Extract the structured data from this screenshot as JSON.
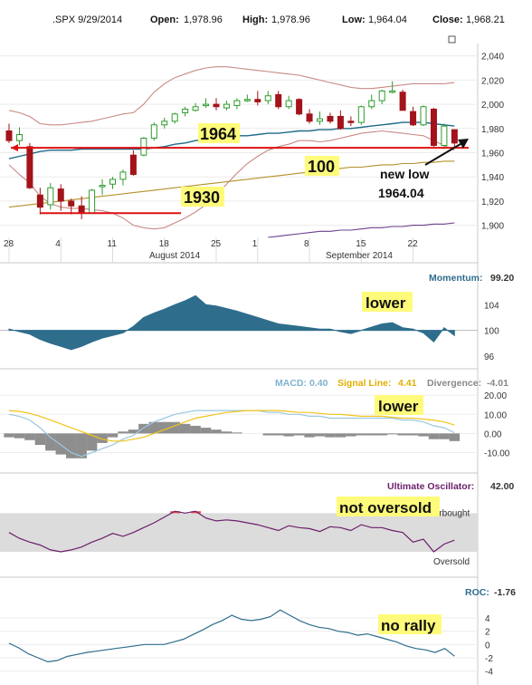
{
  "header": {
    "symbol_date": ".SPX 9/29/2014",
    "open_label": "Open:",
    "open": "1,978.96",
    "high_label": "High:",
    "high": "1,978.96",
    "low_label": "Low:",
    "low": "1,964.04",
    "close_label": "Close:",
    "close": "1,968.21"
  },
  "colors": {
    "up": "#2e9b2e",
    "down": "#a3131a",
    "bollinger": "#c98a84",
    "ma_blue": "#1f6a8a",
    "ma_olive": "#b3912a",
    "ma_purple": "#6b3f8f",
    "annotation_line": "#d11",
    "momentum": "#2f6d8c",
    "macd": "#9cc7e0",
    "signal": "#f0c419",
    "divergence": "#7a7a7a",
    "uo": "#6b1f6b",
    "uo_band": "#dcdcdc",
    "overbought_text": "#d35",
    "oversold_text": "#2aa04a",
    "roc": "#2f6d8c"
  },
  "chart_data": [
    {
      "type": "candlestick",
      "title": ".SPX 9/29/2014",
      "y_ticks": [
        "2,040",
        "2,020",
        "2,000",
        "1,980",
        "1,960",
        "1,940",
        "1,920",
        "1,900"
      ],
      "ylim": [
        1890,
        2045
      ],
      "x_tick_labels": [
        "28",
        "4",
        "11",
        "18",
        "25",
        "1",
        "8",
        "15",
        "22"
      ],
      "month_labels": [
        "August 2014",
        "September 2014"
      ],
      "candles": [
        {
          "o": 1978,
          "h": 1984,
          "l": 1968,
          "c": 1970
        },
        {
          "o": 1970,
          "h": 1981,
          "l": 1966,
          "c": 1975
        },
        {
          "o": 1965,
          "h": 1968,
          "l": 1930,
          "c": 1931
        },
        {
          "o": 1925,
          "h": 1931,
          "l": 1909,
          "c": 1915
        },
        {
          "o": 1917,
          "h": 1935,
          "l": 1913,
          "c": 1931
        },
        {
          "o": 1930,
          "h": 1934,
          "l": 1912,
          "c": 1920
        },
        {
          "o": 1920,
          "h": 1922,
          "l": 1909,
          "c": 1916
        },
        {
          "o": 1916,
          "h": 1924,
          "l": 1905,
          "c": 1910
        },
        {
          "o": 1910,
          "h": 1930,
          "l": 1910,
          "c": 1929
        },
        {
          "o": 1933,
          "h": 1938,
          "l": 1925,
          "c": 1933
        },
        {
          "o": 1934,
          "h": 1940,
          "l": 1930,
          "c": 1938
        },
        {
          "o": 1938,
          "h": 1946,
          "l": 1933,
          "c": 1944
        },
        {
          "o": 1958,
          "h": 1962,
          "l": 1941,
          "c": 1942
        },
        {
          "o": 1958,
          "h": 1973,
          "l": 1957,
          "c": 1972
        },
        {
          "o": 1972,
          "h": 1985,
          "l": 1970,
          "c": 1983
        },
        {
          "o": 1983,
          "h": 1989,
          "l": 1980,
          "c": 1986
        },
        {
          "o": 1986,
          "h": 1993,
          "l": 1984,
          "c": 1992
        },
        {
          "o": 1993,
          "h": 1998,
          "l": 1990,
          "c": 1996
        },
        {
          "o": 1995,
          "h": 2001,
          "l": 1994,
          "c": 1998
        },
        {
          "o": 1999,
          "h": 2005,
          "l": 1997,
          "c": 2000
        },
        {
          "o": 2000,
          "h": 2005,
          "l": 1995,
          "c": 1998
        },
        {
          "o": 1997,
          "h": 2003,
          "l": 1995,
          "c": 2000
        },
        {
          "o": 1999,
          "h": 2005,
          "l": 1996,
          "c": 2003
        },
        {
          "o": 2003,
          "h": 2008,
          "l": 2002,
          "c": 2004
        },
        {
          "o": 2004,
          "h": 2011,
          "l": 1999,
          "c": 2002
        },
        {
          "o": 2003,
          "h": 2011,
          "l": 2000,
          "c": 2007
        },
        {
          "o": 2008,
          "h": 2011,
          "l": 1996,
          "c": 1998
        },
        {
          "o": 1998,
          "h": 2007,
          "l": 1996,
          "c": 2003
        },
        {
          "o": 2004,
          "h": 2005,
          "l": 1991,
          "c": 1992
        },
        {
          "o": 1992,
          "h": 1996,
          "l": 1984,
          "c": 1986
        },
        {
          "o": 1986,
          "h": 1994,
          "l": 1983,
          "c": 1988
        },
        {
          "o": 1990,
          "h": 1993,
          "l": 1984,
          "c": 1986
        },
        {
          "o": 1990,
          "h": 1995,
          "l": 1979,
          "c": 1980
        },
        {
          "o": 1986,
          "h": 1990,
          "l": 1982,
          "c": 1985
        },
        {
          "o": 1985,
          "h": 1999,
          "l": 1983,
          "c": 1998
        },
        {
          "o": 1998,
          "h": 2008,
          "l": 1996,
          "c": 2003
        },
        {
          "o": 2003,
          "h": 2012,
          "l": 2000,
          "c": 2011
        },
        {
          "o": 2011,
          "h": 2019,
          "l": 2009,
          "c": 2011
        },
        {
          "o": 2010,
          "h": 2012,
          "l": 1995,
          "c": 1995
        },
        {
          "o": 1994,
          "h": 1998,
          "l": 1982,
          "c": 1983
        },
        {
          "o": 1983,
          "h": 1999,
          "l": 1982,
          "c": 1998
        },
        {
          "o": 1996,
          "h": 1997,
          "l": 1965,
          "c": 1966
        },
        {
          "o": 1966,
          "h": 1984,
          "l": 1963,
          "c": 1982
        },
        {
          "o": 1979,
          "h": 1979,
          "l": 1964,
          "c": 1968
        }
      ],
      "lines": [
        {
          "name": "bb_upper",
          "values": [
            1995,
            1993,
            1990,
            1984,
            1983,
            1983,
            1984,
            1985,
            1986,
            1988,
            1990,
            1992,
            1993,
            2000,
            2010,
            2017,
            2022,
            2025,
            2028,
            2030,
            2031,
            2031,
            2030,
            2029,
            2028,
            2027,
            2026,
            2025,
            2024,
            2022,
            2020,
            2018,
            2016,
            2014,
            2013,
            2013,
            2014,
            2015,
            2016,
            2017,
            2017,
            2017,
            2017,
            2018
          ]
        },
        {
          "name": "bb_lower",
          "values": [
            1950,
            1942,
            1935,
            1924,
            1918,
            1915,
            1914,
            1914,
            1913,
            1912,
            1910,
            1906,
            1900,
            1898,
            1897,
            1898,
            1902,
            1906,
            1911,
            1917,
            1925,
            1934,
            1943,
            1951,
            1957,
            1962,
            1965,
            1967,
            1970,
            1970,
            1969,
            1970,
            1972,
            1974,
            1976,
            1977,
            1978,
            1977,
            1976,
            1975,
            1974,
            1970,
            1966,
            1962
          ]
        },
        {
          "name": "ma_blue",
          "values": [
            1955,
            1957,
            1959,
            1961,
            1962,
            1962,
            1962,
            1963,
            1963,
            1963,
            1963,
            1963,
            1963,
            1963,
            1964,
            1965,
            1967,
            1968,
            1970,
            1971,
            1972,
            1973,
            1974,
            1974,
            1975,
            1976,
            1976,
            1977,
            1978,
            1978,
            1979,
            1979,
            1980,
            1980,
            1981,
            1982,
            1983,
            1984,
            1985,
            1985,
            1985,
            1984,
            1983,
            1982
          ]
        },
        {
          "name": "ma_olive",
          "values": [
            1915,
            1916,
            1917,
            1918,
            1919,
            1920,
            1921,
            1922,
            1923,
            1924,
            1925,
            1926,
            1927,
            1928,
            1929,
            1930,
            1931,
            1932,
            1933,
            1934,
            1935,
            1936,
            1937,
            1938,
            1939,
            1940,
            1941,
            1942,
            1943,
            1944,
            1945,
            1946,
            1947,
            1948,
            1948,
            1949,
            1950,
            1950,
            1951,
            1951,
            1952,
            1952,
            1953,
            1953
          ]
        },
        {
          "name": "ma_purple",
          "values": [
            null,
            null,
            null,
            null,
            null,
            null,
            null,
            null,
            null,
            null,
            null,
            null,
            null,
            null,
            null,
            null,
            null,
            null,
            null,
            null,
            null,
            null,
            null,
            null,
            null,
            1890,
            1891,
            1892,
            1893,
            1894,
            1895,
            1895,
            1896,
            1896,
            1897,
            1898,
            1898,
            1899,
            1899,
            1900,
            1900,
            1901,
            1901,
            1902
          ]
        }
      ],
      "annotations": {
        "level_1964": "1964",
        "level_100": "100",
        "level_1930": "1930",
        "new_low_line1": "new low",
        "new_low_line2": "1964.04"
      }
    },
    {
      "type": "area",
      "title": "Momentum:",
      "value_text": "99.20",
      "y_ticks": [
        "104",
        "100",
        "96"
      ],
      "ylim": [
        95,
        107
      ],
      "baseline": 100,
      "values": [
        100.2,
        99.8,
        99.4,
        98.6,
        98.0,
        97.5,
        97.0,
        97.5,
        98.2,
        98.8,
        99.2,
        99.6,
        100.6,
        102.0,
        102.7,
        103.3,
        104.0,
        104.6,
        105.4,
        104.0,
        103.8,
        103.4,
        103.0,
        102.5,
        102.0,
        101.5,
        101.0,
        100.8,
        100.6,
        100.4,
        100.2,
        100.2,
        99.8,
        99.5,
        100.0,
        100.5,
        101.0,
        101.2,
        100.4,
        100.2,
        99.6,
        98.2,
        100.4,
        99.2
      ],
      "annotation": "lower"
    },
    {
      "type": "line",
      "title": "MACD:",
      "value_text": "0.40",
      "signal_label": "Signal Line:",
      "signal_value": "4.41",
      "divergence_label": "Divergence:",
      "divergence_value": "-4.01",
      "y_ticks": [
        "20.00",
        "10.00",
        "0.00",
        "-10.00"
      ],
      "ylim": [
        -15,
        22
      ],
      "macd": [
        10,
        9,
        7,
        3,
        -2,
        -6,
        -10,
        -12,
        -10,
        -8,
        -6,
        -3,
        -1,
        3,
        6,
        8,
        10,
        11,
        12,
        12,
        12,
        12,
        12,
        12,
        12,
        11,
        11,
        10,
        10,
        9,
        9,
        8,
        8,
        8,
        8,
        8,
        8,
        8,
        7,
        7,
        6,
        4,
        3,
        0.4
      ],
      "signal": [
        12,
        11.5,
        10.5,
        9,
        7,
        5,
        3,
        1,
        -1,
        -3,
        -4,
        -4,
        -3,
        -2,
        0,
        2,
        4,
        6,
        8,
        9,
        10,
        11,
        11.5,
        12,
        12,
        12,
        12,
        11.5,
        11,
        11,
        10.5,
        10,
        10,
        9.5,
        9,
        9,
        9,
        8.5,
        8,
        8,
        7.5,
        7,
        6,
        4.4
      ],
      "divergence": [
        -2,
        -2.5,
        -3.5,
        -6,
        -9,
        -11,
        -13,
        -13,
        -9,
        -5,
        -2,
        1,
        2,
        5,
        6,
        6,
        6,
        5,
        4,
        3,
        2,
        1,
        0.5,
        0,
        0,
        -1,
        -1,
        -1.5,
        -1,
        -2,
        -1.5,
        -2,
        -2,
        -1.5,
        -1,
        -1,
        -1,
        -0.5,
        -1,
        -1,
        -1.5,
        -3,
        -3,
        -4
      ],
      "annotation": "lower"
    },
    {
      "type": "line",
      "title": "Ultimate Oscillator:",
      "value_text": "42.00",
      "y_ticks": [],
      "ylim": [
        15,
        90
      ],
      "overbought": 70,
      "oversold": 30,
      "overbought_label": "Overbought",
      "oversold_label": "Oversold",
      "values": [
        50,
        44,
        40,
        37,
        32,
        30,
        32,
        35,
        40,
        44,
        49,
        46,
        50,
        55,
        60,
        66,
        72,
        70,
        72,
        65,
        62,
        63,
        62,
        60,
        58,
        55,
        52,
        57,
        55,
        54,
        51,
        56,
        55,
        52,
        58,
        55,
        55,
        52,
        50,
        40,
        43,
        30,
        38,
        42
      ],
      "annotation": "not oversold"
    },
    {
      "type": "line",
      "title": "ROC:",
      "value_text": "-1.76",
      "y_ticks": [
        "4",
        "2",
        "0",
        "-2",
        "-4"
      ],
      "ylim": [
        -5,
        7
      ],
      "values": [
        0.2,
        -0.5,
        -1.4,
        -2.0,
        -2.6,
        -2.4,
        -1.8,
        -1.5,
        -1.2,
        -1.0,
        -0.8,
        -0.6,
        -0.4,
        -0.2,
        0.0,
        0.0,
        0.0,
        0.4,
        0.8,
        1.5,
        2.2,
        3.0,
        3.6,
        4.4,
        3.8,
        3.6,
        3.8,
        4.2,
        5.2,
        4.4,
        3.6,
        3.0,
        2.6,
        2.4,
        2.0,
        1.8,
        1.4,
        1.6,
        1.2,
        0.8,
        0.4,
        -0.2,
        -0.6,
        -0.8,
        -1.2,
        -0.6,
        -1.76
      ],
      "annotation": "no rally"
    }
  ]
}
